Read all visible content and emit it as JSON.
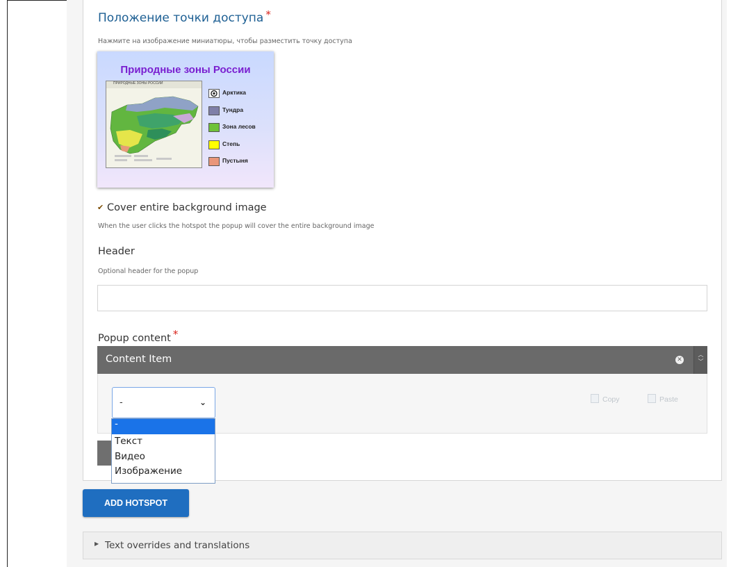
{
  "hotspot_position": {
    "label": "Положение точки доступа",
    "required_mark": "*",
    "hint": "Нажмите на изображение миниатюры, чтобы разместить точку доступа"
  },
  "thumbnail": {
    "title": "Природные зоны России",
    "map_header": "ПРИРОДНЫЕ ЗОНЫ РОССИИ",
    "legend": [
      {
        "label": "Арктика",
        "color": "#ffffff",
        "selected": true
      },
      {
        "label": "Тундра",
        "color": "#7f7fa8"
      },
      {
        "label": "Зона лесов",
        "color": "#6fc23a"
      },
      {
        "label": "Степь",
        "color": "#ffff00"
      },
      {
        "label": "Пустыня",
        "color": "#e9967a"
      }
    ]
  },
  "cover": {
    "checked": true,
    "label": "Cover entire background image",
    "description": "When the user clicks the hotspot the popup will cover the entire background image"
  },
  "header_field": {
    "label": "Header",
    "hint": "Optional header for the popup",
    "value": ""
  },
  "popup_content": {
    "label": "Popup content",
    "required_mark": "*",
    "item_title": "Content Item",
    "select_value": "-",
    "copy_label": "Copy",
    "paste_label": "Paste",
    "options": [
      "-",
      "Текст",
      "Видео",
      "Изображение"
    ],
    "highlighted_option": "-"
  },
  "add_hotspot_label": "ADD HOTSPOT",
  "text_overrides_label": "Text overrides and translations",
  "colors": {
    "accent": "#1f6ec0",
    "required": "#d9241c",
    "label_blue": "#1d5f93",
    "content_bar": "#6a6a6a",
    "option_highlight": "#1a73e8"
  }
}
